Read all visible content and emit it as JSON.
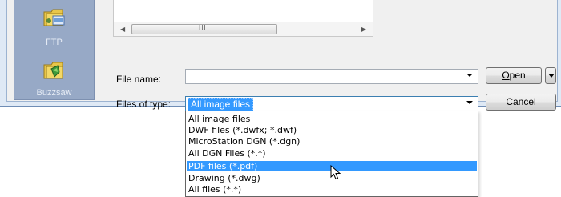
{
  "places": [
    {
      "label": "FTP",
      "icon": "ftp-folder-icon"
    },
    {
      "label": "Buzzsaw",
      "icon": "buzzsaw-folder-icon"
    }
  ],
  "file_list": {
    "scroll_grip": "III"
  },
  "file_name": {
    "label": "File name:",
    "value": ""
  },
  "files_of_type": {
    "label": "Files of type:",
    "value": "All image files"
  },
  "buttons": {
    "open_accel": "O",
    "open_rest": "pen",
    "cancel": "Cancel"
  },
  "dropdown": {
    "options": [
      "All image files",
      "DWF files (*.dwfx; *.dwf)",
      "MicroStation DGN (*.dgn)",
      "All DGN Files (*.*)",
      "PDF files (*.pdf)",
      "Drawing (*.dwg)",
      "All files (*.*)"
    ],
    "highlighted_index": 4
  },
  "colors": {
    "places_bar": "#97a9c6",
    "selection": "#3399ff"
  }
}
